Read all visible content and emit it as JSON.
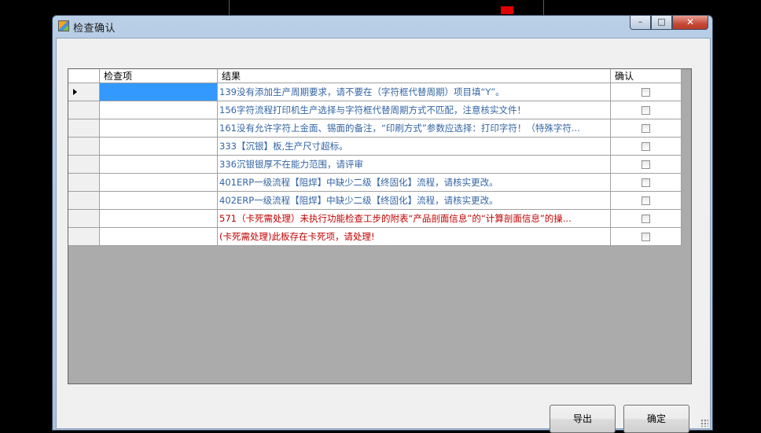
{
  "window": {
    "title": "检查确认",
    "controls": {
      "minimize_icon": "minimize-icon",
      "maximize_icon": "maximize-icon",
      "close_icon": "close-icon"
    }
  },
  "grid": {
    "columns": [
      "检查项",
      "结果",
      "确认"
    ],
    "selected_row": 0,
    "rows": [
      {
        "item": "",
        "result": "139没有添加生产周期要求，请不要在（字符框代替周期）项目填“Y”。",
        "result_color": "#3465a4",
        "confirmed": false
      },
      {
        "item": "",
        "result": "156字符流程打印机生产选择与字符框代替周期方式不匹配，注意核实文件！",
        "result_color": "#3465a4",
        "confirmed": false
      },
      {
        "item": "",
        "result": "161没有允许字符上金面、锡面的备注，“印刷方式”参数应选择：打印字符！（特殊字符...",
        "result_color": "#3465a4",
        "confirmed": false
      },
      {
        "item": "",
        "result": "333【沉银】板,生产尺寸超标。",
        "result_color": "#3465a4",
        "confirmed": false
      },
      {
        "item": "",
        "result": "336沉银银厚不在能力范围，请评审",
        "result_color": "#3465a4",
        "confirmed": false
      },
      {
        "item": "",
        "result": "401ERP一级流程【阻焊】中缺少二级【终固化】流程，请核实更改。",
        "result_color": "#3465a4",
        "confirmed": false
      },
      {
        "item": "",
        "result": "402ERP一级流程【阻焊】中缺少二级【终固化】流程，请核实更改。",
        "result_color": "#3465a4",
        "confirmed": false
      },
      {
        "item": "",
        "result": "571（卡死需处理）未执行功能检查工步的附表“产品剖面信息”的“计算剖面信息”的操...",
        "result_color": "#c00000",
        "confirmed": false
      },
      {
        "item": "",
        "result": "(卡死需处理)此板存在卡死项，请处理!",
        "result_color": "#c00000",
        "confirmed": false
      }
    ]
  },
  "buttons": {
    "export": "导出",
    "ok": "确定"
  },
  "colors": {
    "info_text": "#3465a4",
    "error_text": "#c00000",
    "selection": "#3399ff",
    "grid_background": "#ababab"
  }
}
